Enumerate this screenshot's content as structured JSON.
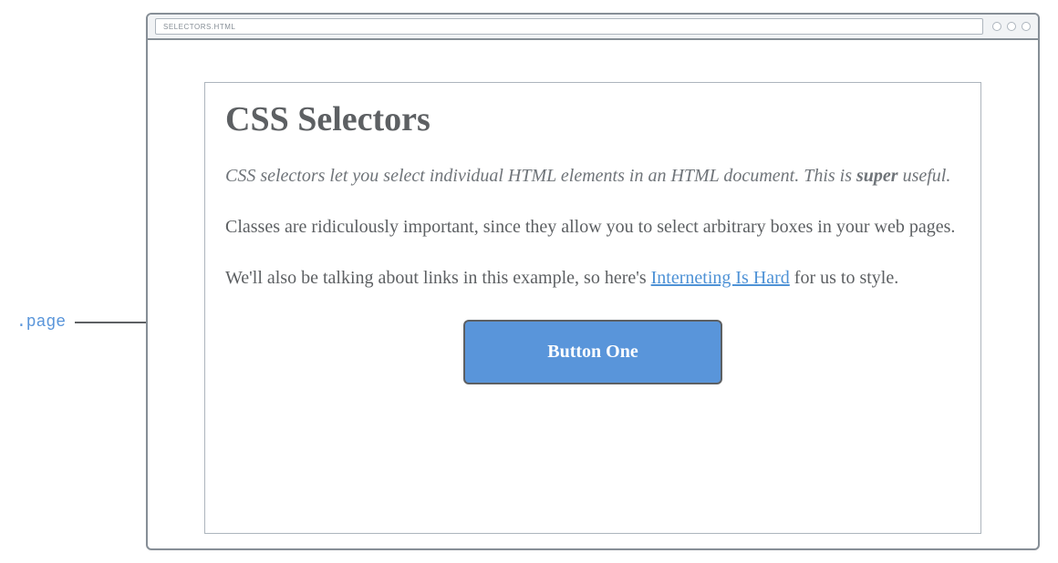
{
  "url_bar": {
    "text": "SELECTORS.HTML"
  },
  "annotation": {
    "label": ".page"
  },
  "page": {
    "title": "CSS Selectors",
    "intro_prefix": "CSS selectors let you select individual HTML elements in an HTML document. This is ",
    "intro_strong": "super",
    "intro_suffix": " useful.",
    "para2": "Classes are ridiculously important, since they allow you to select arbitrary boxes in your web pages.",
    "para3_prefix": "We'll also be talking about links in this example, so here's ",
    "link_text": "Interneting Is Hard",
    "para3_suffix": " for us to style.",
    "button_label": "Button One"
  }
}
